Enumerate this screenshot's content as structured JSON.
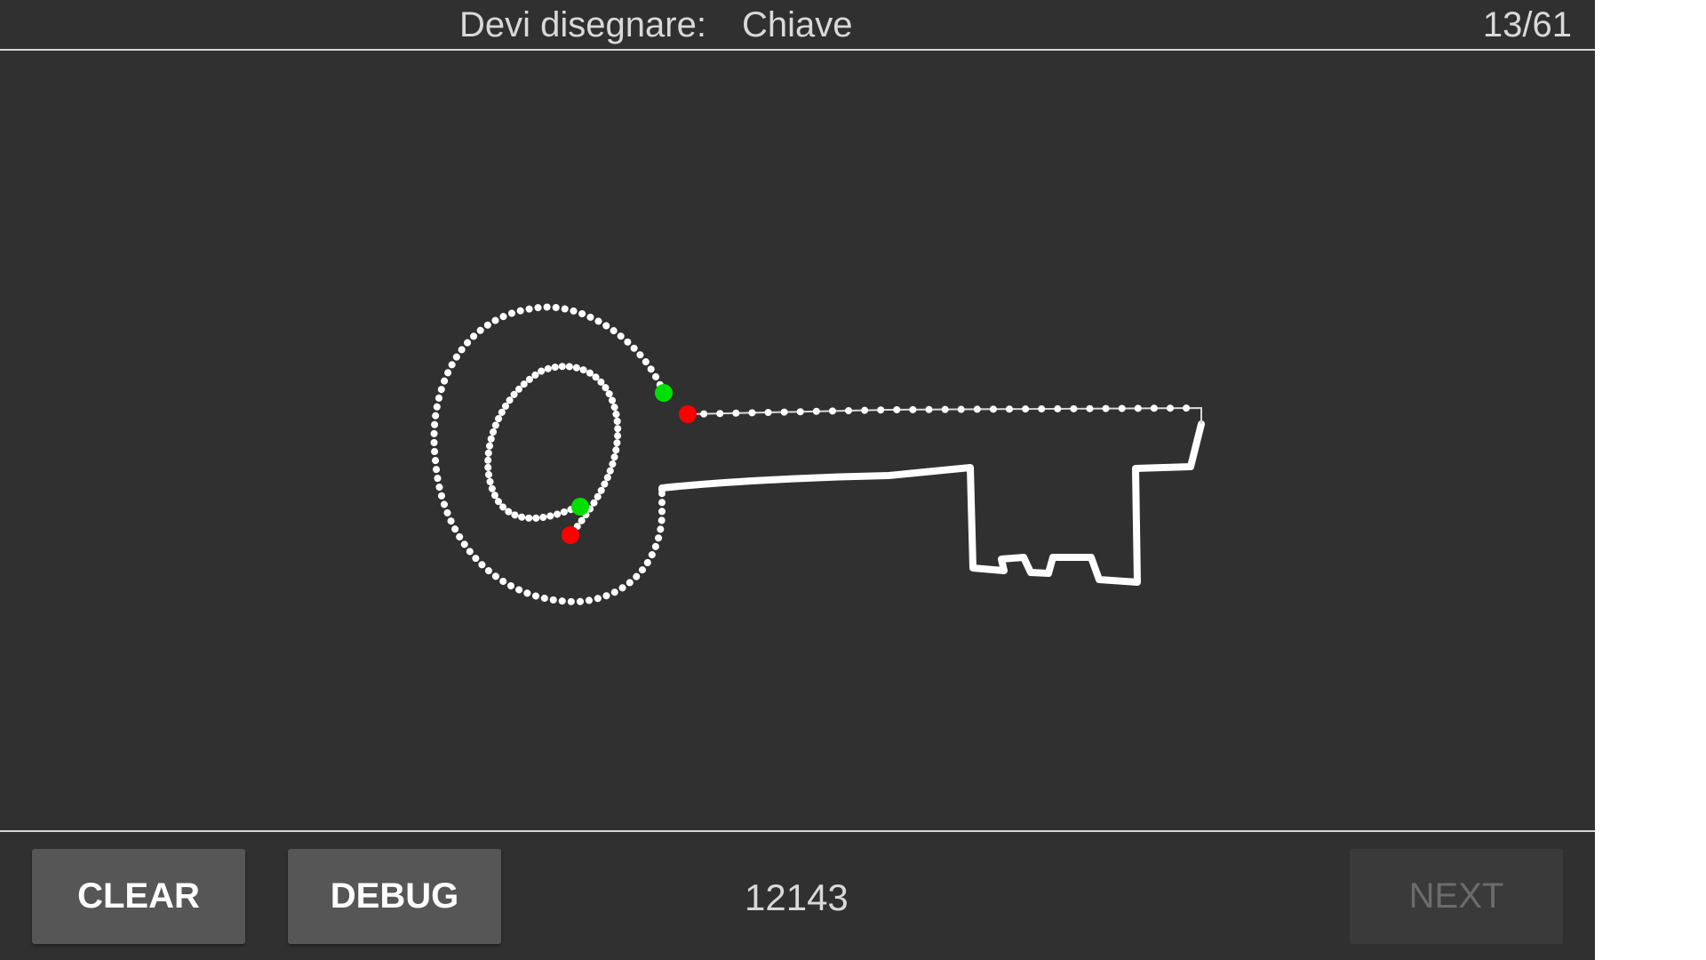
{
  "header": {
    "prompt_label": "Devi disegnare:",
    "word": "Chiave",
    "progress": "13/61"
  },
  "canvas": {
    "drawing_subject": "key",
    "stroke_color": "#ffffff",
    "start_marker_color": "#00e000",
    "end_marker_color": "#ff0000",
    "background_color": "#303030"
  },
  "footer": {
    "clear_label": "CLEAR",
    "debug_label": "DEBUG",
    "score": "12143",
    "next_label": "NEXT"
  }
}
